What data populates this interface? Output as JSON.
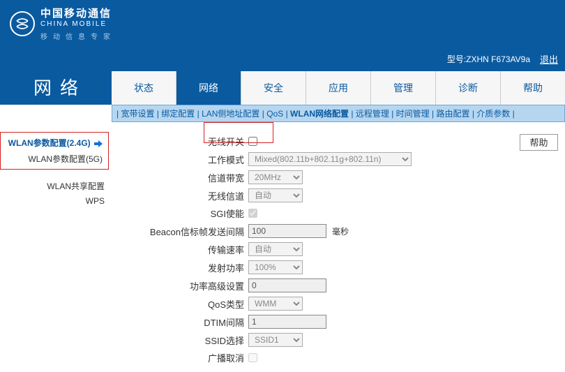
{
  "brand": {
    "cn": "中国移动通信",
    "en": "CHINA MOBILE",
    "sub": "移动信息专家"
  },
  "subbar": {
    "type_label": "型号:",
    "model": "ZXHN F673AV9a",
    "logout": "退出"
  },
  "page_title": "网络",
  "tabs": [
    "状态",
    "网络",
    "安全",
    "应用",
    "管理",
    "诊断",
    "帮助"
  ],
  "subtabs": [
    "宽带设置",
    "绑定配置",
    "LAN侧地址配置",
    "QoS",
    "WLAN网络配置",
    "远程管理",
    "时间管理",
    "路由配置",
    "介质参数"
  ],
  "sidebar": {
    "group": [
      "WLAN参数配置(2.4G)",
      "WLAN参数配置(5G)"
    ],
    "rest": [
      "WLAN共享配置",
      "WPS"
    ]
  },
  "form": {
    "wireless_switch": "无线开关",
    "work_mode": {
      "label": "工作模式",
      "value": "Mixed(802.11b+802.11g+802.11n)"
    },
    "channel_bw": {
      "label": "信道带宽",
      "value": "20MHz"
    },
    "wireless_channel": {
      "label": "无线信道",
      "value": "自动"
    },
    "sgi": "SGI使能",
    "beacon": {
      "label": "Beacon信标帧发送间隔",
      "value": "100",
      "unit": "毫秒"
    },
    "tx_rate": {
      "label": "传输速率",
      "value": "自动"
    },
    "tx_power": {
      "label": "发射功率",
      "value": "100%"
    },
    "power_adv": {
      "label": "功率高级设置",
      "value": "0"
    },
    "qos_type": {
      "label": "QoS类型",
      "value": "WMM"
    },
    "dtim": {
      "label": "DTIM间隔",
      "value": "1"
    },
    "ssid_sel": {
      "label": "SSID选择",
      "value": "SSID1"
    },
    "broadcast_cancel": "广播取消"
  },
  "help_button": "帮助"
}
